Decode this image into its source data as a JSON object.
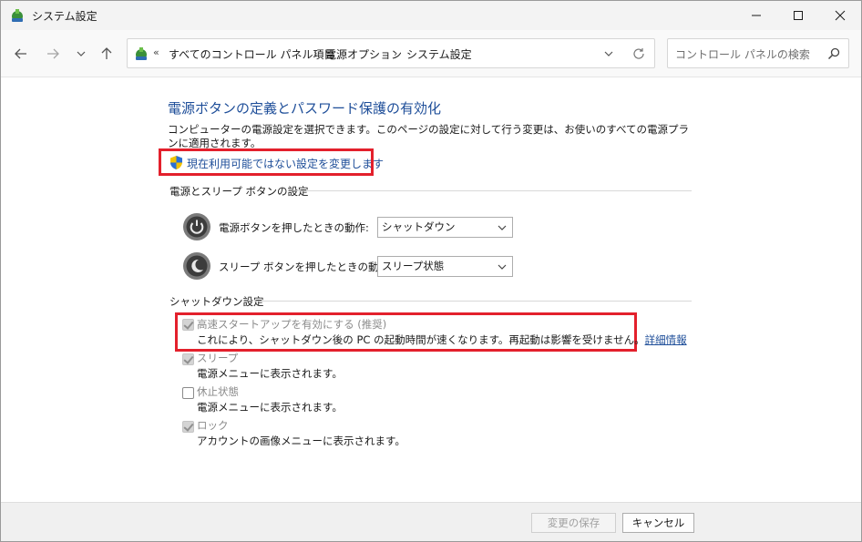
{
  "window": {
    "title": "システム設定"
  },
  "nav": {
    "breadcrumbs": [
      "すべてのコントロール パネル項目",
      "電源オプション",
      "システム設定"
    ],
    "overflow": "«",
    "search_placeholder": "コントロール パネルの検索"
  },
  "page": {
    "heading": "電源ボタンの定義とパスワード保護の有効化",
    "description": "コンピューターの電源設定を選択できます。このページの設定に対して行う変更は、お使いのすべての電源プランに適用されます。",
    "change_link": "現在利用可能ではない設定を変更します"
  },
  "power_section": {
    "title": "電源とスリープ ボタンの設定",
    "power_button": {
      "label": "電源ボタンを押したときの動作:",
      "value": "シャットダウン"
    },
    "sleep_button": {
      "label": "スリープ ボタンを押したときの動作:",
      "value": "スリープ状態"
    }
  },
  "shutdown_section": {
    "title": "シャットダウン設定",
    "fast_startup": {
      "label": "高速スタートアップを有効にする (推奨)",
      "description": "これにより、シャットダウン後の PC の起動時間が速くなります。再起動は影響を受けません。",
      "link": "詳細情報",
      "checked": true
    },
    "sleep": {
      "label": "スリープ",
      "description": "電源メニューに表示されます。",
      "checked": true
    },
    "hibernate": {
      "label": "休止状態",
      "description": "電源メニューに表示されます。",
      "checked": false
    },
    "lock": {
      "label": "ロック",
      "description": "アカウントの画像メニューに表示されます。",
      "checked": true
    }
  },
  "footer": {
    "save_label": "変更の保存",
    "cancel_label": "キャンセル"
  },
  "colors": {
    "accent": "#1e4e99",
    "highlight": "#e3202c"
  }
}
